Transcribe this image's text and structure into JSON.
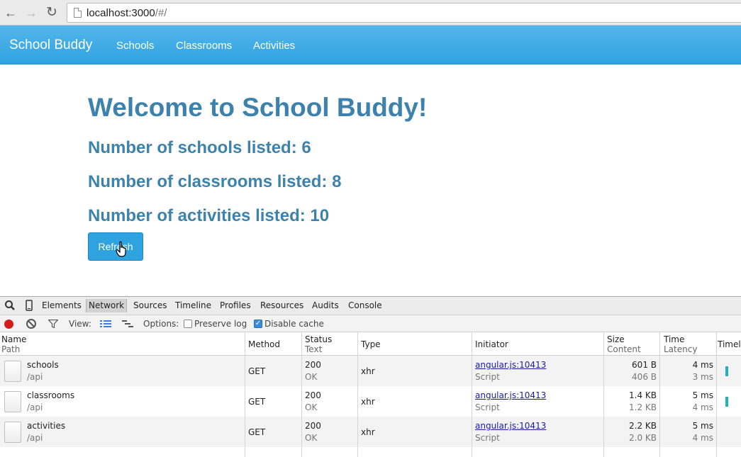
{
  "browser": {
    "url_host": "localhost:3000",
    "url_path": "/#/"
  },
  "navbar": {
    "brand": "School Buddy",
    "links": [
      "Schools",
      "Classrooms",
      "Activities"
    ]
  },
  "main": {
    "title": "Welcome to School Buddy!",
    "schools_count": "Number of schools listed: 6",
    "classrooms_count": "Number of classrooms listed: 8",
    "activities_count": "Number of activities listed: 10",
    "refresh_label": "Refresh"
  },
  "devtools": {
    "tabs": [
      "Elements",
      "Network",
      "Sources",
      "Timeline",
      "Profiles",
      "Resources",
      "Audits",
      "Console"
    ],
    "active_tab": "Network",
    "toolbar": {
      "view_label": "View:",
      "options_label": "Options:",
      "preserve_log": "Preserve log",
      "disable_cache": "Disable cache",
      "preserve_log_checked": false,
      "disable_cache_checked": true
    },
    "columns": {
      "name": "Name",
      "path": "Path",
      "method": "Method",
      "status": "Status",
      "text": "Text",
      "type": "Type",
      "initiator": "Initiator",
      "size": "Size",
      "content": "Content",
      "time": "Time",
      "latency": "Latency",
      "timeline": "Timeli"
    },
    "rows": [
      {
        "name": "schools",
        "path": "/api",
        "method": "GET",
        "status": "200",
        "status_text": "OK",
        "type": "xhr",
        "initiator": "angular.js:10413",
        "initiator_type": "Script",
        "size": "601 B",
        "content": "406 B",
        "time": "4 ms",
        "latency": "3 ms"
      },
      {
        "name": "classrooms",
        "path": "/api",
        "method": "GET",
        "status": "200",
        "status_text": "OK",
        "type": "xhr",
        "initiator": "angular.js:10413",
        "initiator_type": "Script",
        "size": "1.4 KB",
        "content": "1.2 KB",
        "time": "5 ms",
        "latency": "4 ms"
      },
      {
        "name": "activities",
        "path": "/api",
        "method": "GET",
        "status": "200",
        "status_text": "OK",
        "type": "xhr",
        "initiator": "angular.js:10413",
        "initiator_type": "Script",
        "size": "2.2 KB",
        "content": "2.0 KB",
        "time": "5 ms",
        "latency": "4 ms"
      }
    ]
  },
  "colors": {
    "navbar": "#2ea3e0",
    "heading": "#3d82ad",
    "record": "#d61b1b",
    "timing": "#1fb3b3"
  }
}
